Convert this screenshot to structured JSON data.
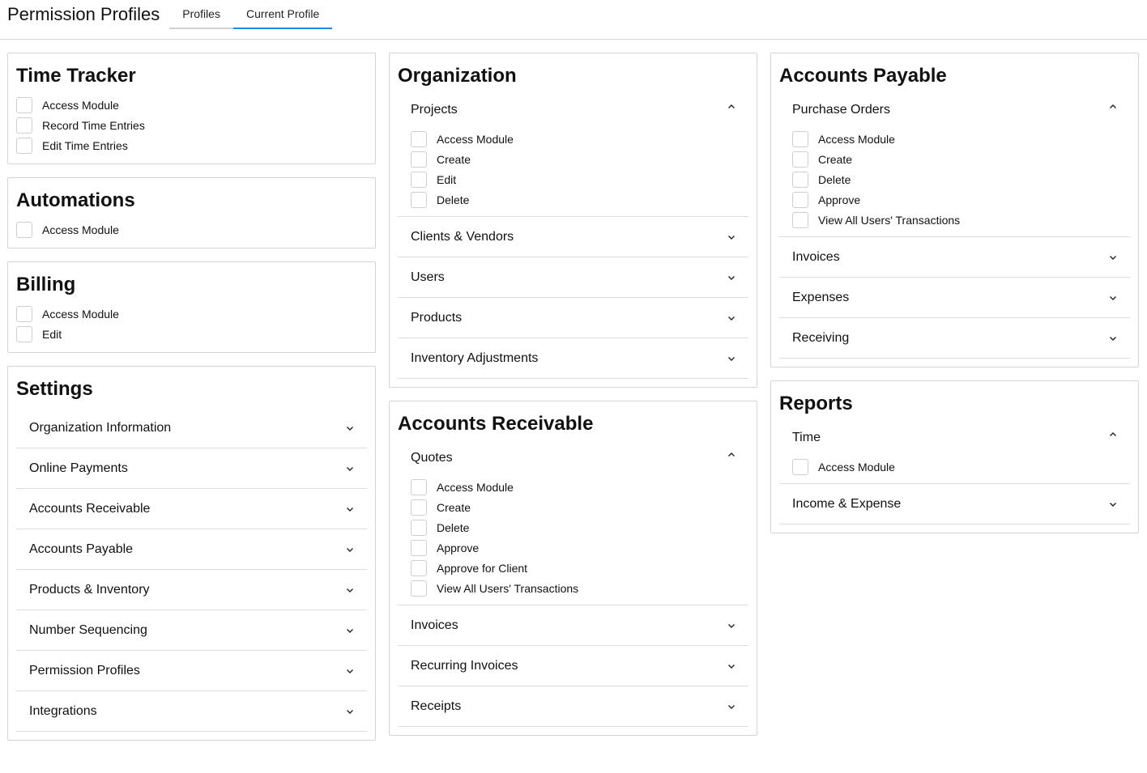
{
  "header": {
    "title": "Permission Profiles",
    "tabs": [
      "Profiles",
      "Current Profile"
    ]
  },
  "accent_color": "#1e88e5",
  "time_tracker": {
    "title": "Time Tracker",
    "items": [
      "Access Module",
      "Record Time Entries",
      "Edit Time Entries"
    ]
  },
  "automations": {
    "title": "Automations",
    "items": [
      "Access Module"
    ]
  },
  "billing": {
    "title": "Billing",
    "items": [
      "Access Module",
      "Edit"
    ]
  },
  "settings": {
    "title": "Settings",
    "sections": [
      "Organization Information",
      "Online Payments",
      "Accounts Receivable",
      "Accounts Payable",
      "Products & Inventory",
      "Number Sequencing",
      "Permission Profiles",
      "Integrations"
    ]
  },
  "organization": {
    "title": "Organization",
    "open_section": {
      "label": "Projects",
      "items": [
        "Access Module",
        "Create",
        "Edit",
        "Delete"
      ]
    },
    "sections": [
      "Clients & Vendors",
      "Users",
      "Products",
      "Inventory Adjustments"
    ]
  },
  "accounts_receivable": {
    "title": "Accounts Receivable",
    "open_section": {
      "label": "Quotes",
      "items": [
        "Access Module",
        "Create",
        "Delete",
        "Approve",
        "Approve for Client",
        "View All Users' Transactions"
      ]
    },
    "sections": [
      "Invoices",
      "Recurring Invoices",
      "Receipts"
    ]
  },
  "accounts_payable": {
    "title": "Accounts Payable",
    "open_section": {
      "label": "Purchase Orders",
      "items": [
        "Access Module",
        "Create",
        "Delete",
        "Approve",
        "View All Users' Transactions"
      ]
    },
    "sections": [
      "Invoices",
      "Expenses",
      "Receiving"
    ]
  },
  "reports": {
    "title": "Reports",
    "open_section": {
      "label": "Time",
      "items": [
        "Access Module"
      ]
    },
    "sections": [
      "Income & Expense"
    ]
  }
}
